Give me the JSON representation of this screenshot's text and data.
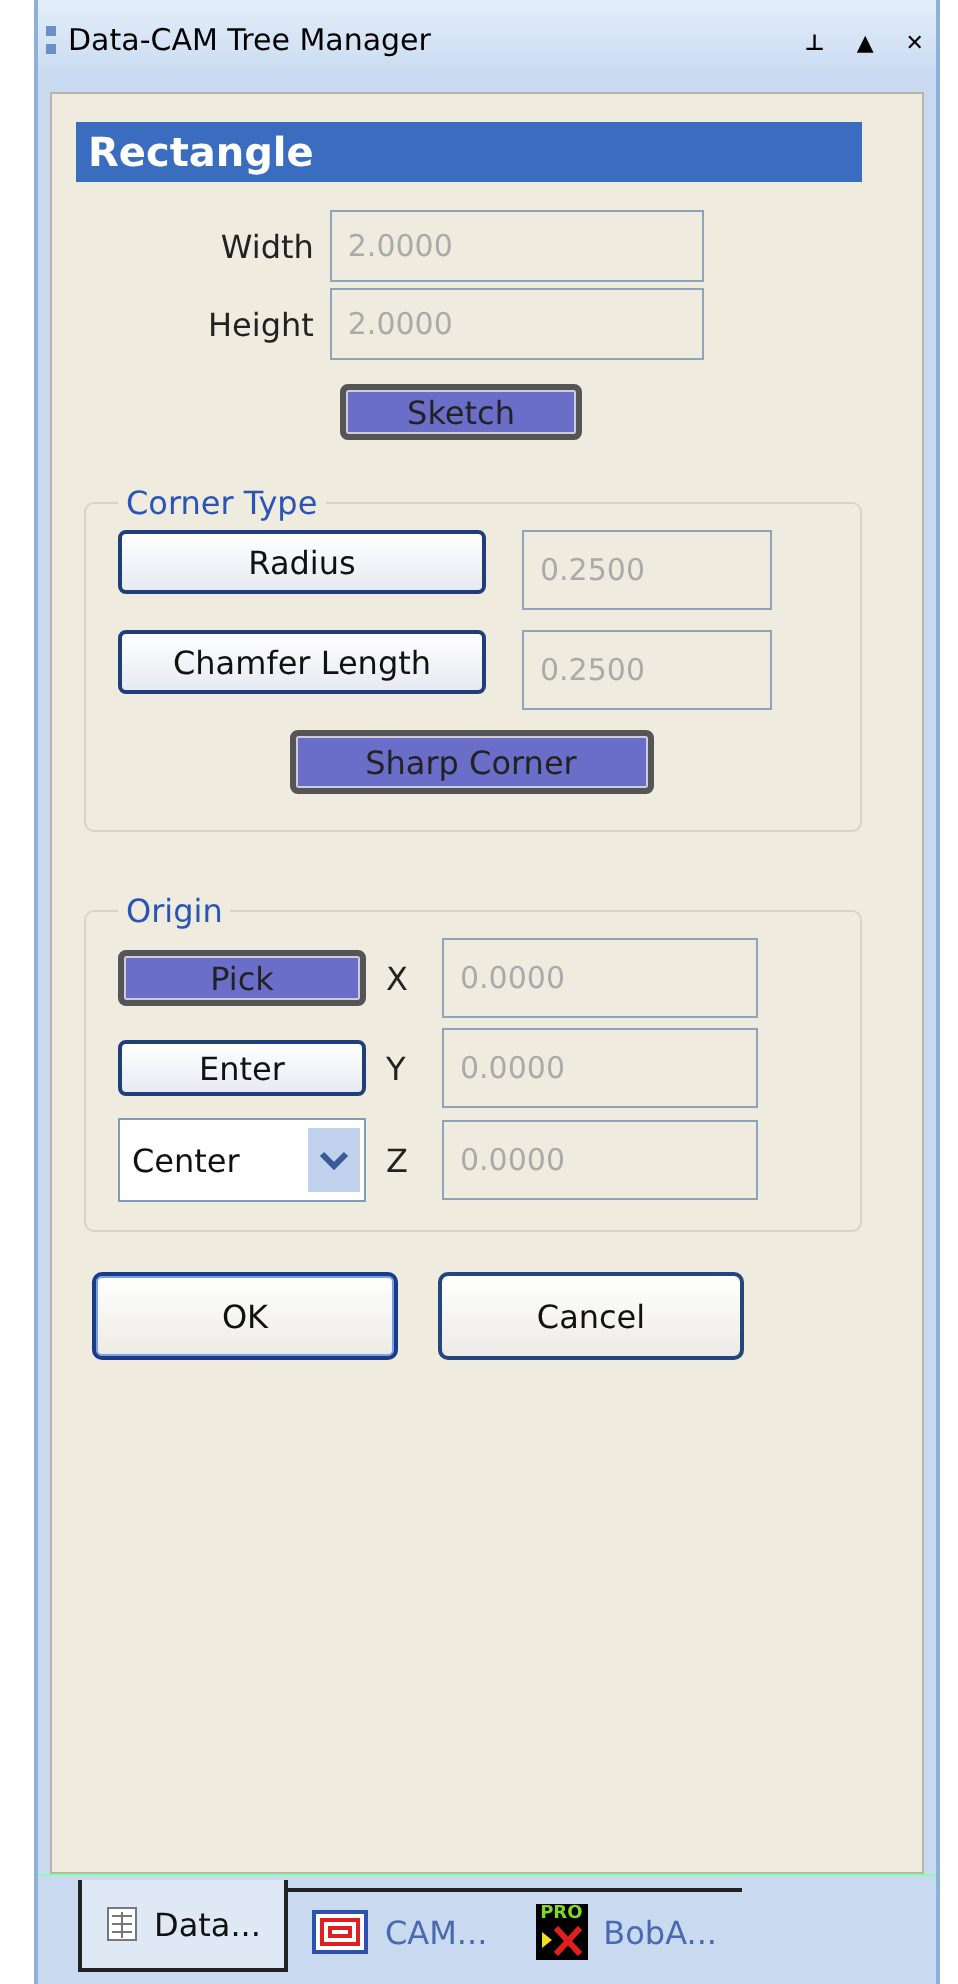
{
  "window": {
    "title": "Data-CAM Tree Manager",
    "controls": [
      "⊥",
      "▲",
      "✕"
    ]
  },
  "panel": {
    "heading": "Rectangle",
    "size_fields": [
      {
        "label": "Width",
        "value": "2.0000"
      },
      {
        "label": "Height",
        "value": "2.0000"
      }
    ],
    "sketch_button": {
      "label": "Sketch",
      "pressed": true
    },
    "corner_type": {
      "legend": "Corner Type",
      "options": [
        {
          "label": "Radius",
          "pressed": false,
          "value": "0.2500"
        },
        {
          "label": "Chamfer Length",
          "pressed": false,
          "value": "0.2500"
        }
      ],
      "sharp_button": {
        "label": "Sharp Corner",
        "pressed": true
      }
    },
    "origin": {
      "legend": "Origin",
      "rows": [
        {
          "kind": "button",
          "label": "Pick",
          "pressed": true,
          "axis": "X",
          "value": "0.0000"
        },
        {
          "kind": "button",
          "label": "Enter",
          "pressed": false,
          "axis": "Y",
          "value": "0.0000"
        },
        {
          "kind": "dropdown",
          "label": "Center",
          "axis": "Z",
          "value": "0.0000"
        }
      ]
    },
    "buttons": [
      {
        "label": "OK",
        "default": true
      },
      {
        "label": "Cancel",
        "default": false
      }
    ]
  },
  "tabs": [
    {
      "label": "Data...",
      "selected": true,
      "kind": "grid"
    },
    {
      "label": "CAM...",
      "selected": false,
      "kind": "frame"
    },
    {
      "label": "BobA...",
      "selected": false,
      "kind": "pro",
      "icon_text": "PRO"
    }
  ]
}
